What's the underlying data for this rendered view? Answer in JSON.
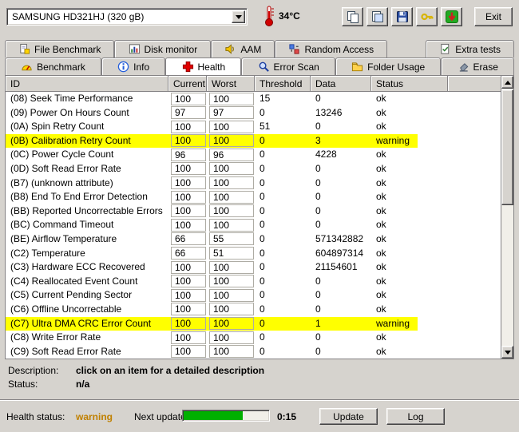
{
  "colors": {
    "highlight_row": "#ffff00",
    "warning_text": "#c08000",
    "progress_green": "#00b000",
    "health_cross_red": "#e00000"
  },
  "toolbar": {
    "drive_select": "SAMSUNG HD321HJ (320 gB)",
    "temperature": "34°C",
    "thermometer_icon": "thermometer-icon",
    "buttons": [
      {
        "name": "copy-button",
        "icon": "copy-icon"
      },
      {
        "name": "copy-image-button",
        "icon": "copy-image-icon"
      },
      {
        "name": "save-button",
        "icon": "save-icon"
      },
      {
        "name": "options-button",
        "icon": "options-key-icon"
      },
      {
        "name": "update-check-button",
        "icon": "update-check-icon"
      }
    ],
    "exit_label": "Exit"
  },
  "tabs": {
    "row1": [
      {
        "label": "File Benchmark",
        "icon": "file-benchmark-icon",
        "active": false
      },
      {
        "label": "Disk monitor",
        "icon": "disk-monitor-icon",
        "active": false
      },
      {
        "label": "AAM",
        "icon": "aam-icon",
        "active": false
      },
      {
        "label": "Random Access",
        "icon": "random-access-icon",
        "active": false
      },
      {
        "label": "Extra tests",
        "icon": "extra-tests-icon",
        "active": false,
        "push_right": true
      }
    ],
    "row2": [
      {
        "label": "Benchmark",
        "icon": "benchmark-icon",
        "active": false
      },
      {
        "label": "Info",
        "icon": "info-icon",
        "active": false
      },
      {
        "label": "Health",
        "icon": "health-icon",
        "active": true
      },
      {
        "label": "Error Scan",
        "icon": "error-scan-icon",
        "active": false
      },
      {
        "label": "Folder Usage",
        "icon": "folder-usage-icon",
        "active": false
      },
      {
        "label": "Erase",
        "icon": "erase-icon",
        "active": false
      }
    ]
  },
  "table": {
    "headers": [
      "ID",
      "Current",
      "Worst",
      "Threshold",
      "Data",
      "Status"
    ],
    "rows": [
      {
        "id": "(08) Seek Time Performance",
        "current": "100",
        "worst": "100",
        "threshold": "15",
        "data": "0",
        "status": "ok",
        "highlight": false
      },
      {
        "id": "(09) Power On Hours Count",
        "current": "97",
        "worst": "97",
        "threshold": "0",
        "data": "13246",
        "status": "ok",
        "highlight": false
      },
      {
        "id": "(0A) Spin Retry Count",
        "current": "100",
        "worst": "100",
        "threshold": "51",
        "data": "0",
        "status": "ok",
        "highlight": false
      },
      {
        "id": "(0B) Calibration Retry Count",
        "current": "100",
        "worst": "100",
        "threshold": "0",
        "data": "3",
        "status": "warning",
        "highlight": true
      },
      {
        "id": "(0C) Power Cycle Count",
        "current": "96",
        "worst": "96",
        "threshold": "0",
        "data": "4228",
        "status": "ok",
        "highlight": false
      },
      {
        "id": "(0D) Soft Read Error Rate",
        "current": "100",
        "worst": "100",
        "threshold": "0",
        "data": "0",
        "status": "ok",
        "highlight": false
      },
      {
        "id": "(B7) (unknown attribute)",
        "current": "100",
        "worst": "100",
        "threshold": "0",
        "data": "0",
        "status": "ok",
        "highlight": false
      },
      {
        "id": "(B8) End To End Error Detection",
        "current": "100",
        "worst": "100",
        "threshold": "0",
        "data": "0",
        "status": "ok",
        "highlight": false
      },
      {
        "id": "(BB) Reported Uncorrectable Errors",
        "current": "100",
        "worst": "100",
        "threshold": "0",
        "data": "0",
        "status": "ok",
        "highlight": false
      },
      {
        "id": "(BC) Command Timeout",
        "current": "100",
        "worst": "100",
        "threshold": "0",
        "data": "0",
        "status": "ok",
        "highlight": false
      },
      {
        "id": "(BE) Airflow Temperature",
        "current": "66",
        "worst": "55",
        "threshold": "0",
        "data": "571342882",
        "status": "ok",
        "highlight": false
      },
      {
        "id": "(C2) Temperature",
        "current": "66",
        "worst": "51",
        "threshold": "0",
        "data": "604897314",
        "status": "ok",
        "highlight": false
      },
      {
        "id": "(C3) Hardware ECC Recovered",
        "current": "100",
        "worst": "100",
        "threshold": "0",
        "data": "21154601",
        "status": "ok",
        "highlight": false
      },
      {
        "id": "(C4) Reallocated Event Count",
        "current": "100",
        "worst": "100",
        "threshold": "0",
        "data": "0",
        "status": "ok",
        "highlight": false
      },
      {
        "id": "(C5) Current Pending Sector",
        "current": "100",
        "worst": "100",
        "threshold": "0",
        "data": "0",
        "status": "ok",
        "highlight": false
      },
      {
        "id": "(C6) Offline Uncorrectable",
        "current": "100",
        "worst": "100",
        "threshold": "0",
        "data": "0",
        "status": "ok",
        "highlight": false
      },
      {
        "id": "(C7) Ultra DMA CRC Error Count",
        "current": "100",
        "worst": "100",
        "threshold": "0",
        "data": "1",
        "status": "warning",
        "highlight": true
      },
      {
        "id": "(C8) Write Error Rate",
        "current": "100",
        "worst": "100",
        "threshold": "0",
        "data": "0",
        "status": "ok",
        "highlight": false
      },
      {
        "id": "(C9) Soft Read Error Rate",
        "current": "100",
        "worst": "100",
        "threshold": "0",
        "data": "0",
        "status": "ok",
        "highlight": false
      }
    ]
  },
  "details": {
    "description_label": "Description:",
    "description_value": "click on an item for a detailed description",
    "status_label": "Status:",
    "status_value": "n/a"
  },
  "footer": {
    "health_status_label": "Health status:",
    "health_status_value": "warning",
    "next_update_label": "Next update:",
    "progress_percent": 70,
    "countdown": "0:15",
    "update_label": "Update",
    "log_label": "Log"
  }
}
